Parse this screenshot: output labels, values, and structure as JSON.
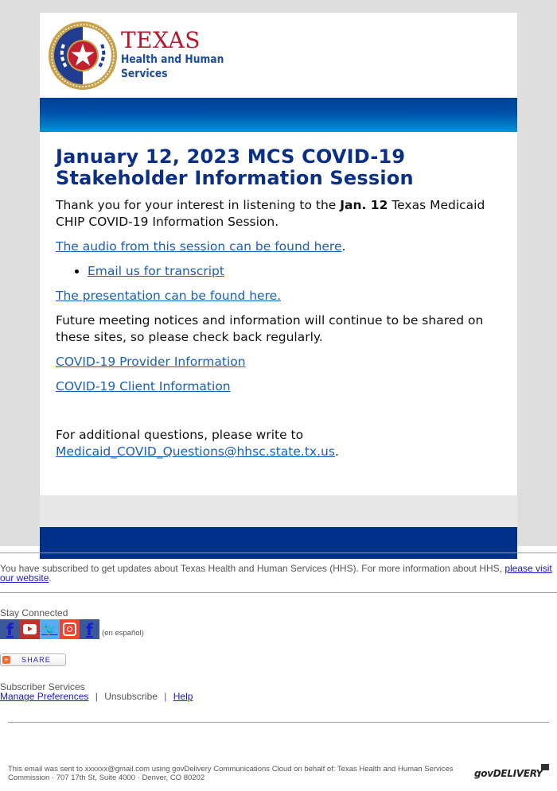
{
  "header": {
    "logo": {
      "title": "TEXAS",
      "subtitle_line1": "Health and Human",
      "subtitle_line2": "Services",
      "seal_icon": "texas-star-seal-icon",
      "colors": {
        "title": "#b5172b",
        "subtitle": "#1f4c9a",
        "seal_gold": "#c9a14a",
        "seal_blue": "#213d8f",
        "seal_red": "#c0202e"
      }
    },
    "banner_colors": {
      "top": "#003f96",
      "bottom": "#0093d6"
    }
  },
  "article": {
    "title": "January 12, 2023 MCS COVID-19 Stakeholder Information Session",
    "intro_before_bold": "Thank you for your interest in listening to the ",
    "intro_bold": "Jan. 12",
    "intro_after_bold": " Texas Medicaid CHIP COVID-19 Information Session.",
    "audio_link": "The audio from this session can be found here",
    "audio_suffix": ".",
    "transcript_link": "Email us for transcript",
    "presentation_link": "The presentation can be found here.",
    "future_text": "Future meeting notices and information will continue to be shared on these sites, so please check back regularly.",
    "provider_link": "COVID-19 Provider Information",
    "client_link": "COVID-19 Client Information",
    "questions_text": "For additional questions, please write to",
    "questions_email": "Medicaid_COVID_Questions@hhsc.state.tx.us",
    "questions_suffix": "."
  },
  "footer": {
    "subscribe_text": "You have subscribed to get updates about Texas Health and Human Services (HHS). For more information about HHS, ",
    "subscribe_link": "please visit our website",
    "subscribe_suffix": ".",
    "stay_connected": "Stay Connected",
    "social": [
      {
        "name": "facebook-icon",
        "glyph": "f",
        "color": "#3b5998"
      },
      {
        "name": "youtube-icon",
        "glyph": "▶",
        "color": "#c4302b"
      },
      {
        "name": "twitter-icon",
        "glyph": "t",
        "color": "#55acee"
      },
      {
        "name": "instagram-icon",
        "glyph": "◎",
        "color": "#e1306c"
      },
      {
        "name": "facebook-espanol-icon",
        "glyph": "f",
        "color": "#3b5998"
      }
    ],
    "en_espanol": "(en español)",
    "share_label": "SHARE",
    "share_plus": "+",
    "subscriber_services": "Subscriber Services",
    "manage_preferences": "Manage Preferences",
    "separator": "|",
    "unsubscribe": "Unsubscribe",
    "help": "Help",
    "sent_to": "This email was sent to xxxxxx@gmail.com using govDelivery Communications Cloud on behalf of: Texas Health and Human Services Commission · 707 17th St, Suite 4000 · Denver, CO 80202",
    "govdelivery_logo": "govDELIVERY"
  }
}
